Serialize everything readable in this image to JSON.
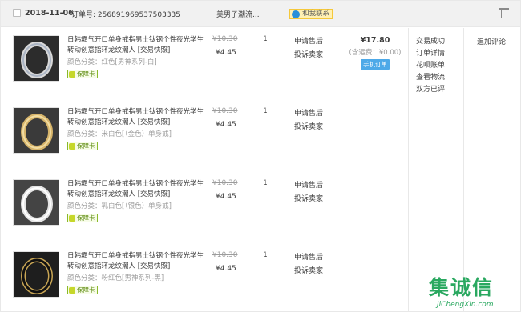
{
  "order": {
    "date": "2018-11-06",
    "order_no_label": "订单号:",
    "order_no": "256891969537503335",
    "shop": "美男子潮流...",
    "contact_label": "和我联系"
  },
  "items": [
    {
      "title": "日韩霸气开口单身戒指男士钛钢个性夜光学生转动创意指环龙纹潮人 [交易快照]",
      "attr": "颜色分类：红色[男神系列-白]",
      "guard": "保障卡",
      "orig_price": "¥10.30",
      "price": "¥4.45",
      "qty": "1",
      "svc1": "申请售后",
      "svc2": "投诉卖家"
    },
    {
      "title": "日韩霸气开口单身戒指男士钛钢个性夜光学生转动创意指环龙纹潮人 [交易快照]",
      "attr": "颜色分类：米白色[（金色）单身戒]",
      "guard": "保障卡",
      "orig_price": "¥10.30",
      "price": "¥4.45",
      "qty": "1",
      "svc1": "申请售后",
      "svc2": "投诉卖家"
    },
    {
      "title": "日韩霸气开口单身戒指男士钛钢个性夜光学生转动创意指环龙纹潮人 [交易快照]",
      "attr": "颜色分类：乳白色[（银色）单身戒]",
      "guard": "保障卡",
      "orig_price": "¥10.30",
      "price": "¥4.45",
      "qty": "1",
      "svc1": "申请售后",
      "svc2": "投诉卖家"
    },
    {
      "title": "日韩霸气开口单身戒指男士钛钢个性夜光学生转动创意指环龙纹潮人 [交易快照]",
      "attr": "颜色分类：粉红色[男神系列-黑]",
      "guard": "保障卡",
      "orig_price": "¥10.30",
      "price": "¥4.45",
      "qty": "1",
      "svc1": "申请售后",
      "svc2": "投诉卖家"
    }
  ],
  "total": {
    "amount": "¥17.80",
    "shipping": "(含运费：¥0.00)",
    "mobile_label": "手机订单"
  },
  "status": [
    "交易成功",
    "订单详情",
    "花呗账单",
    "查看物流",
    "双方已评"
  ],
  "review": "追加评论",
  "watermark": {
    "logo": "集诚信",
    "url": "JiChengXin.com"
  },
  "colors": {
    "header_bg": "#f1f1f1",
    "mobile_badge": "#4da9e8",
    "guard_border": "#8ab92a",
    "watermark": "#2aa860"
  },
  "icons": [
    "checkbox-icon",
    "chat-icon",
    "trash-icon",
    "guard-icon"
  ]
}
